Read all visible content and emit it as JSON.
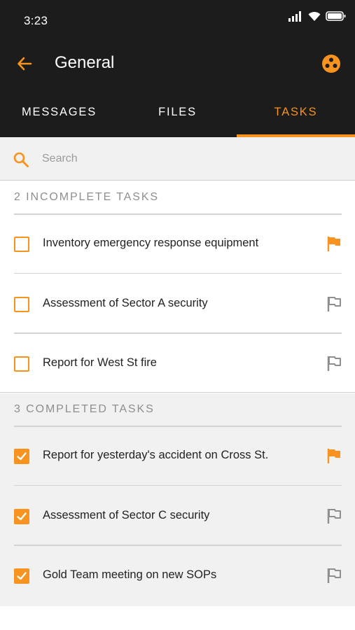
{
  "status_bar": {
    "time": "3:23"
  },
  "header": {
    "title": "General",
    "back_icon": "arrow-left-icon",
    "team_icon": "team-icon"
  },
  "tabs": [
    {
      "label": "MESSAGES",
      "active": false
    },
    {
      "label": "FILES",
      "active": false
    },
    {
      "label": "TASKS",
      "active": true
    }
  ],
  "search": {
    "placeholder": "Search",
    "value": ""
  },
  "colors": {
    "accent": "#f7931e",
    "header_bg": "#1c1c1c",
    "flag_inactive": "#8e8e8e"
  },
  "incomplete": {
    "header": "2 INCOMPLETE TASKS",
    "tasks": [
      {
        "label": "Inventory emergency response equipment",
        "checked": false,
        "flagged": true
      },
      {
        "label": "Assessment of Sector A security",
        "checked": false,
        "flagged": false
      },
      {
        "label": "Report for West St fire",
        "checked": false,
        "flagged": false
      }
    ]
  },
  "complete": {
    "header": "3 COMPLETED TASKS",
    "tasks": [
      {
        "label": "Report for yesterday's accident on Cross St.",
        "checked": true,
        "flagged": true
      },
      {
        "label": "Assessment of Sector C security",
        "checked": true,
        "flagged": false
      },
      {
        "label": "Gold Team meeting on new SOPs",
        "checked": true,
        "flagged": false
      }
    ]
  }
}
